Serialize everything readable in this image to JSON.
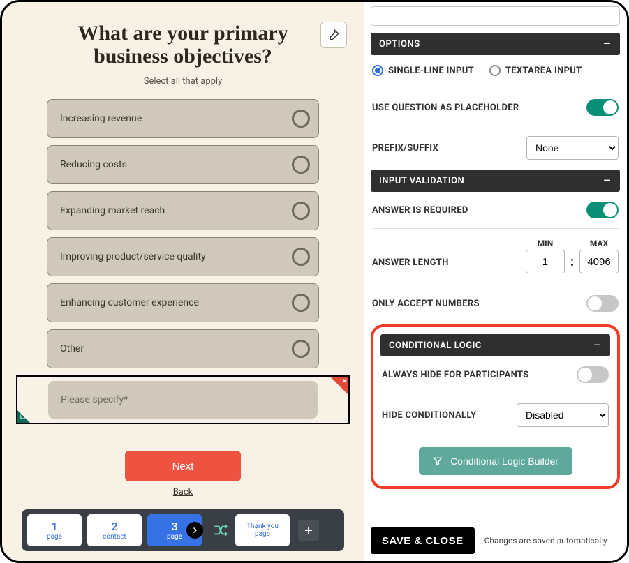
{
  "preview": {
    "question_title": "What are your primary business objectives?",
    "question_subtitle": "Select all that apply",
    "answers": [
      "Increasing revenue",
      "Reducing costs",
      "Expanding market reach",
      "Improving product/service quality",
      "Enhancing customer experience",
      "Other"
    ],
    "specify_placeholder": "Please specify*",
    "next_label": "Next",
    "back_label": "Back"
  },
  "tray": {
    "tabs": [
      {
        "num": "1",
        "label": "page"
      },
      {
        "num": "2",
        "label": "contact"
      },
      {
        "num": "3",
        "label": "page"
      }
    ],
    "thank_you_label_top": "Thank you",
    "thank_you_label_bottom": "page"
  },
  "settings": {
    "options": {
      "header": "OPTIONS",
      "single_line_label": "SINGLE-LINE INPUT",
      "textarea_label": "TEXTAREA INPUT",
      "use_placeholder_label": "USE QUESTION AS PLACEHOLDER",
      "use_placeholder_on": true,
      "prefix_suffix_label": "PREFIX/SUFFIX",
      "prefix_suffix_value": "None"
    },
    "validation": {
      "header": "INPUT VALIDATION",
      "required_label": "ANSWER IS REQUIRED",
      "required_on": true,
      "length_label": "ANSWER LENGTH",
      "min_label": "MIN",
      "max_label": "MAX",
      "min_value": "1",
      "max_value": "4096",
      "numbers_label": "ONLY ACCEPT NUMBERS",
      "numbers_on": false
    },
    "conditional": {
      "header": "CONDITIONAL LOGIC",
      "always_hide_label": "ALWAYS HIDE FOR PARTICIPANTS",
      "always_hide_on": false,
      "hide_cond_label": "HIDE CONDITIONALLY",
      "hide_cond_value": "Disabled",
      "builder_label": "Conditional Logic Builder"
    },
    "footer": {
      "save_label": "SAVE & CLOSE",
      "note": "Changes are saved automatically"
    }
  }
}
